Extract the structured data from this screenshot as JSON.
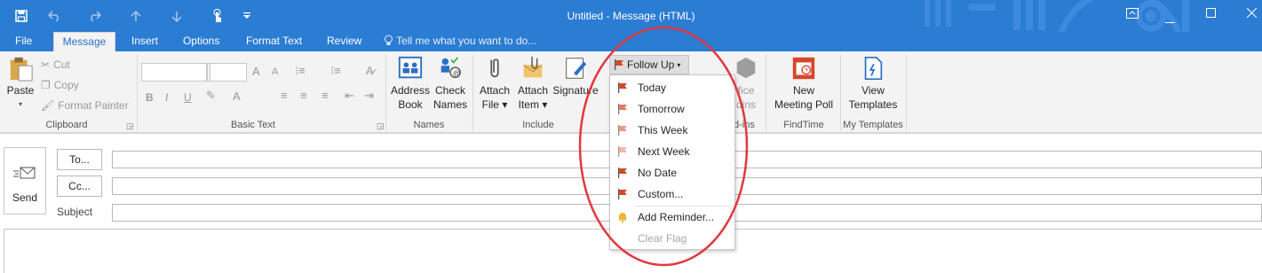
{
  "window": {
    "title": "Untitled - Message (HTML)"
  },
  "qat": {
    "save_icon": "save-icon",
    "undo_icon": "undo-icon",
    "redo_icon": "redo-icon",
    "up_icon": "up-arrow-icon",
    "down_icon": "down-arrow-icon",
    "touch_icon": "touch-mode-icon",
    "customize_icon": "customize-qat-icon"
  },
  "tabs": [
    {
      "label": "File"
    },
    {
      "label": "Message"
    },
    {
      "label": "Insert"
    },
    {
      "label": "Options"
    },
    {
      "label": "Format Text"
    },
    {
      "label": "Review"
    }
  ],
  "tellme": {
    "label": "Tell me what you want to do..."
  },
  "ribbon": {
    "clipboard": {
      "label": "Clipboard",
      "paste": "Paste",
      "cut": "Cut",
      "copy": "Copy",
      "format_painter": "Format Painter"
    },
    "basic_text": {
      "label": "Basic Text",
      "bold": "B",
      "italic": "I",
      "underline": "U",
      "grow": "A",
      "shrink": "A"
    },
    "names": {
      "label": "Names",
      "address_book_1": "Address",
      "address_book_2": "Book",
      "check_names_1": "Check",
      "check_names_2": "Names"
    },
    "include": {
      "label": "Include",
      "attach_file_1": "Attach",
      "attach_file_2": "File",
      "attach_item_1": "Attach",
      "attach_item_2": "Item",
      "signature": "Signature"
    },
    "addins": {
      "label_partial": "d-ins",
      "office_1": "fice",
      "office_2": "dins"
    },
    "findtime": {
      "label": "FindTime",
      "new_poll_1": "New",
      "new_poll_2": "Meeting Poll"
    },
    "my_templates": {
      "label": "My Templates",
      "view_1": "View",
      "view_2": "Templates"
    }
  },
  "followup": {
    "button_label": "Follow Up",
    "items": [
      {
        "label": "Today",
        "flag": "#d24726"
      },
      {
        "label": "Tomorrow",
        "flag": "#e07b5f"
      },
      {
        "label": "This Week",
        "flag": "#e89a86"
      },
      {
        "label": "Next Week",
        "flag": "#efb6a8"
      },
      {
        "label": "No Date",
        "flag": "#d24726"
      },
      {
        "label": "Custom...",
        "flag": "#d24726"
      },
      {
        "label": "Add Reminder...",
        "icon": "bell-icon"
      },
      {
        "label": "Clear Flag",
        "disabled": true
      }
    ]
  },
  "compose": {
    "send": "Send",
    "to": "To...",
    "cc": "Cc...",
    "subject": "Subject"
  },
  "colors": {
    "titlebar": "#2b7cd3",
    "annotation": "#e0393e",
    "flag": "#d24726"
  }
}
